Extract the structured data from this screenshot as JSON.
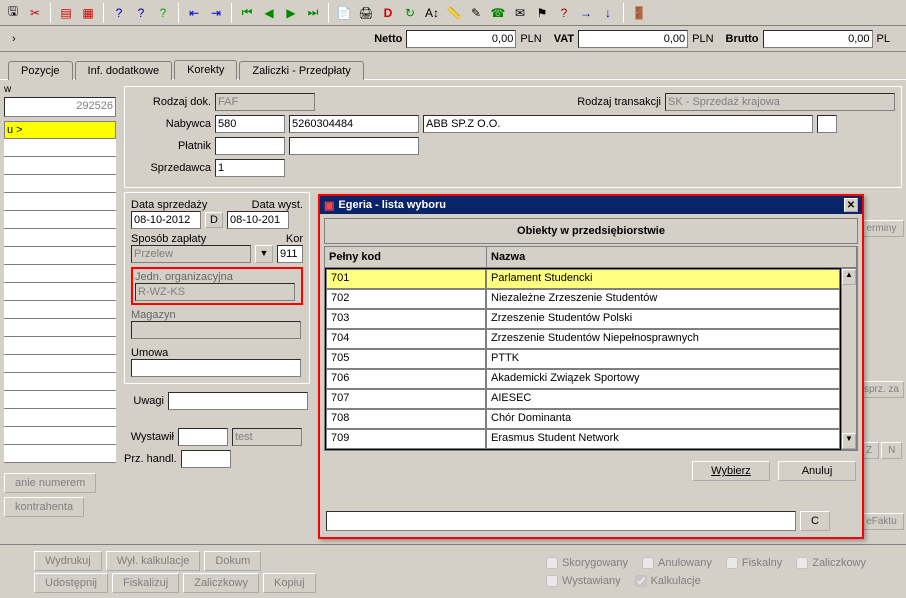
{
  "totals": {
    "netto_label": "Netto",
    "netto": "0,00",
    "vat_label": "VAT",
    "vat": "0,00",
    "brutto_label": "Brutto",
    "brutto": "0,00",
    "currency": "PLN",
    "currency_short": "PL"
  },
  "tabs": {
    "pozycje": "Pozycje",
    "inf": "Inf. dodatkowe",
    "korekty": "Korekty",
    "zaliczki": "Zaliczki - Przedpłaty"
  },
  "left": {
    "number": "292526",
    "highlight": "u >"
  },
  "form": {
    "rodzaj_dok_label": "Rodzaj dok.",
    "rodzaj_dok": "FAF",
    "rodzaj_trans_label": "Rodzaj transakcji",
    "rodzaj_trans": "SK - Sprzedaż krajowa",
    "nabywca_label": "Nabywca",
    "nabywca_code": "580",
    "nabywca_nip": "5260304484",
    "nabywca_name": "ABB SP.Z O.O.",
    "platnik_label": "Płatnik",
    "sprzedawca_label": "Sprzedawca",
    "sprzedawca_code": "1",
    "data_sprzedazy_label": "Data sprzedaży",
    "data_sprzedazy": "08-10-2012",
    "d_btn": "D",
    "data_wyst_label": "Data wyst.",
    "data_wyst": "08-10-201",
    "sposob_label": "Sposób zapłaty",
    "sposob": "Przelew",
    "kor_label": "Kor",
    "kor": "911",
    "jedn_label": "Jedn. organizacyjna",
    "jedn": "R-WZ-KS",
    "magazyn_label": "Magazyn",
    "umowa_label": "Umowa",
    "uwagi_label": "Uwagi",
    "wystawil_label": "Wystawił",
    "wystawil": "test",
    "prz_label": "Prz. handl."
  },
  "rightbtns": {
    "terminy": "erminy",
    "sprz": "sprz. za",
    "zn": "Z",
    "nn": "N",
    "efakt": "eFaktu"
  },
  "side_btns": {
    "anie": "anie numerem",
    "kontr": "kontrahenta"
  },
  "bottom_btns": {
    "wydrukuj": "Wydrukuj",
    "wyl": "Wył. kalkulacje",
    "dokum": "Dokum",
    "udostepnij": "Udostępnij",
    "fiskalizuj": "Fiskalizuj",
    "zaliczkowy": "Zaliczkowy",
    "kopiuj": "Kopiuj"
  },
  "checks": {
    "skorygowany": "Skorygowany",
    "anulowany": "Anulowany",
    "fiskalny": "Fiskalny",
    "zaliczkowy": "Zaliczkowy",
    "wystawiany": "Wystawiany",
    "kalkulacje": "Kalkulacje"
  },
  "modal": {
    "title": "Egeria - lista wyboru",
    "heading": "Obiekty w przedsiębiorstwie",
    "col_code": "Pełny kod",
    "col_name": "Nazwa",
    "rows": [
      {
        "code": "701",
        "name": "Parlament Studencki"
      },
      {
        "code": "702",
        "name": "Niezależne Zrzeszenie Studentów"
      },
      {
        "code": "703",
        "name": "Zrzeszenie Studentów Polski"
      },
      {
        "code": "704",
        "name": "Zrzeszenie Studentów Niepełnosprawnych"
      },
      {
        "code": "705",
        "name": "PTTK"
      },
      {
        "code": "706",
        "name": "Akademicki Związek Sportowy"
      },
      {
        "code": "707",
        "name": "AIESEC"
      },
      {
        "code": "708",
        "name": "Chór Dominanta"
      },
      {
        "code": "709",
        "name": "Erasmus Student Network"
      }
    ],
    "wybierz": "Wybierz",
    "anuluj": "Anuluj",
    "c_btn": "C"
  }
}
